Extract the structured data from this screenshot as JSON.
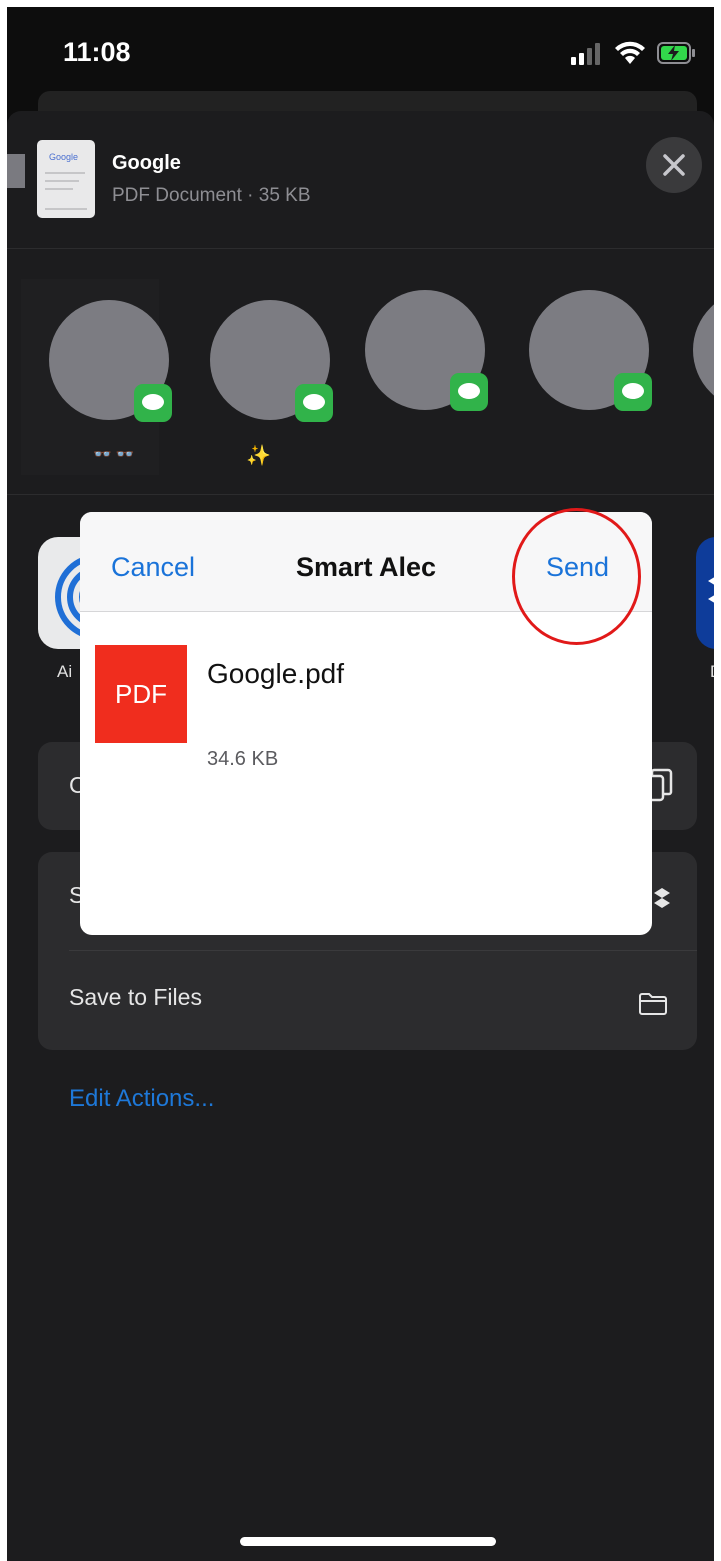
{
  "status_bar": {
    "time": "11:08"
  },
  "share_sheet": {
    "document": {
      "title": "Google",
      "subtitle": "PDF Document · 35 KB",
      "thumb_text": "Google"
    },
    "contacts": [
      {
        "label": "👓 👓"
      },
      {
        "label": "✨"
      },
      {
        "label": ""
      },
      {
        "label": ""
      }
    ],
    "apps": {
      "left_label": "Ai",
      "right_label": "D"
    },
    "action_rows": {
      "row1_label": "C",
      "row2_label": "S",
      "save_to_files": "Save to Files"
    },
    "edit_actions": "Edit Actions..."
  },
  "modal": {
    "cancel_label": "Cancel",
    "title": "Smart Alec",
    "send_label": "Send",
    "file": {
      "icon_text": "PDF",
      "name": "Google.pdf",
      "size": "34.6 KB"
    }
  },
  "colors": {
    "accent": "#1a73d9",
    "pdf_red": "#f02d1e",
    "annotation_red": "#e11919",
    "messages_green": "#31b34a"
  }
}
